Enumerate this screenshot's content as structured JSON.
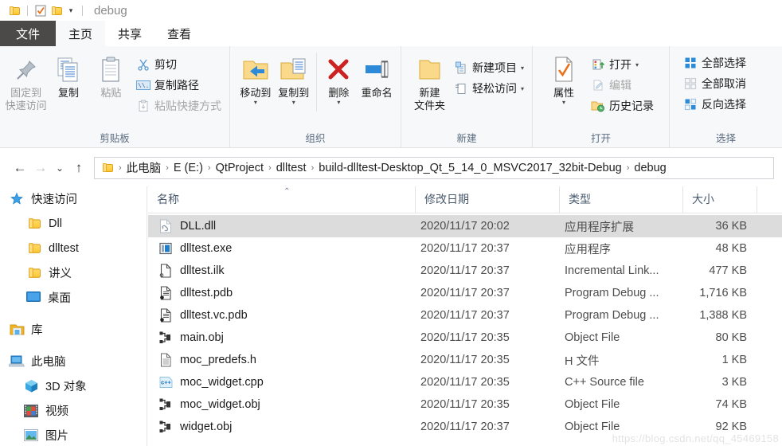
{
  "titlebar": {
    "title": "debug",
    "qat": [
      {
        "name": "folder-icon",
        "label": "folder"
      },
      {
        "name": "properties-check-icon",
        "label": "properties"
      },
      {
        "name": "new-folder-icon",
        "label": "new folder"
      }
    ],
    "customize_caret": "▾"
  },
  "tabs": [
    {
      "id": "file",
      "label": "文件",
      "state": "file"
    },
    {
      "id": "home",
      "label": "主页",
      "state": "active"
    },
    {
      "id": "share",
      "label": "共享",
      "state": "normal"
    },
    {
      "id": "view",
      "label": "查看",
      "state": "normal"
    }
  ],
  "ribbon": {
    "groups": [
      {
        "id": "clipboard",
        "title": "剪贴板",
        "big": [
          {
            "name": "pin-to-quick-access-button",
            "icon": "pin-icon",
            "line1": "固定到",
            "line2": "快速访问",
            "dim": true
          },
          {
            "name": "copy-button",
            "icon": "copy-icon",
            "line1": "复制",
            "line2": "",
            "dim": false
          },
          {
            "name": "paste-button",
            "icon": "paste-icon",
            "line1": "粘贴",
            "line2": "",
            "dim": true
          }
        ],
        "small": [
          {
            "name": "cut-button",
            "icon": "scissors-icon",
            "label": "剪切",
            "dim": false,
            "caret": ""
          },
          {
            "name": "copy-path-button",
            "icon": "copy-path-icon",
            "label": "复制路径",
            "dim": false,
            "caret": ""
          },
          {
            "name": "paste-shortcut-button",
            "icon": "paste-shortcut-icon",
            "label": "粘贴快捷方式",
            "dim": true,
            "caret": ""
          }
        ]
      },
      {
        "id": "organize",
        "title": "组织",
        "big": [
          {
            "name": "move-to-button",
            "icon": "move-to-icon",
            "line1": "移动到",
            "line2": "",
            "caret": "▾"
          },
          {
            "name": "copy-to-button",
            "icon": "copy-to-icon",
            "line1": "复制到",
            "line2": "",
            "caret": "▾"
          },
          {
            "name": "delete-button",
            "icon": "delete-x-icon",
            "line1": "删除",
            "line2": "",
            "caret": "▾"
          },
          {
            "name": "rename-button",
            "icon": "rename-icon",
            "line1": "重命名",
            "line2": "",
            "caret": ""
          }
        ],
        "small": []
      },
      {
        "id": "new",
        "title": "新建",
        "big": [
          {
            "name": "new-folder-button",
            "icon": "new-folder-icon",
            "line1": "新建",
            "line2": "文件夹",
            "caret": ""
          }
        ],
        "small": [
          {
            "name": "new-item-button",
            "icon": "new-item-icon",
            "label": "新建项目",
            "dim": false,
            "caret": "▾"
          },
          {
            "name": "easy-access-button",
            "icon": "easy-access-icon",
            "label": "轻松访问",
            "dim": false,
            "caret": "▾"
          }
        ]
      },
      {
        "id": "open",
        "title": "打开",
        "big": [
          {
            "name": "properties-button",
            "icon": "properties-icon",
            "line1": "属性",
            "line2": "",
            "caret": "▾"
          }
        ],
        "small": [
          {
            "name": "open-button",
            "icon": "open-icon",
            "label": "打开",
            "dim": false,
            "caret": "▾"
          },
          {
            "name": "edit-button",
            "icon": "edit-icon",
            "label": "编辑",
            "dim": true,
            "caret": ""
          },
          {
            "name": "history-button",
            "icon": "history-icon",
            "label": "历史记录",
            "dim": false,
            "caret": ""
          }
        ]
      },
      {
        "id": "select",
        "title": "选择",
        "big": [],
        "small": [
          {
            "name": "select-all-button",
            "icon": "select-all-icon",
            "label": "全部选择",
            "dim": false,
            "caret": ""
          },
          {
            "name": "select-none-button",
            "icon": "select-none-icon",
            "label": "全部取消",
            "dim": false,
            "caret": ""
          },
          {
            "name": "invert-selection-button",
            "icon": "invert-selection-icon",
            "label": "反向选择",
            "dim": false,
            "caret": ""
          }
        ]
      }
    ]
  },
  "addressbar": {
    "back": "←",
    "forward": "→",
    "recent": "⌄",
    "up": "↑",
    "separator": "›",
    "crumbs": [
      "此电脑",
      "E (E:)",
      "QtProject",
      "dlltest",
      "build-dlltest-Desktop_Qt_5_14_0_MSVC2017_32bit-Debug",
      "debug"
    ]
  },
  "navpane": {
    "items": [
      {
        "name": "sidebar-item-quick-access",
        "icon": "star-pin-icon",
        "label": "快速访问",
        "indent": 10
      },
      {
        "name": "sidebar-item-dll",
        "icon": "folder-icon",
        "label": "Dll",
        "indent": 32
      },
      {
        "name": "sidebar-item-dlltest",
        "icon": "folder-icon",
        "label": "dlltest",
        "indent": 32
      },
      {
        "name": "sidebar-item-jiangyi",
        "icon": "folder-icon",
        "label": "讲义",
        "indent": 32
      },
      {
        "name": "sidebar-item-desktop",
        "icon": "desktop-icon",
        "label": "桌面",
        "indent": 32
      },
      {
        "name": "sidebar-item-libraries",
        "icon": "library-icon",
        "label": "库",
        "indent": 10
      },
      {
        "name": "sidebar-item-this-pc",
        "icon": "pc-icon",
        "label": "此电脑",
        "indent": 10
      },
      {
        "name": "sidebar-item-3d-objects",
        "icon": "cube-icon",
        "label": "3D 对象",
        "indent": 28
      },
      {
        "name": "sidebar-item-videos",
        "icon": "video-icon",
        "label": "视频",
        "indent": 28
      },
      {
        "name": "sidebar-item-pictures",
        "icon": "pictures-icon",
        "label": "图片",
        "indent": 28
      }
    ]
  },
  "filelist": {
    "columns": [
      {
        "name": "column-header-name",
        "label": "名称",
        "sorted": true,
        "sort_caret": "⌃"
      },
      {
        "name": "column-header-date",
        "label": "修改日期",
        "sorted": false,
        "sort_caret": ""
      },
      {
        "name": "column-header-type",
        "label": "类型",
        "sorted": false,
        "sort_caret": ""
      },
      {
        "name": "column-header-size",
        "label": "大小",
        "sorted": false,
        "sort_caret": ""
      }
    ],
    "rows": [
      {
        "icon": "dll-file-icon",
        "name": "DLL.dll",
        "date": "2020/11/17 20:02",
        "type": "应用程序扩展",
        "size": "36 KB",
        "selected": true
      },
      {
        "icon": "exe-file-icon",
        "name": "dlltest.exe",
        "date": "2020/11/17 20:37",
        "type": "应用程序",
        "size": "48 KB",
        "selected": false
      },
      {
        "icon": "ilk-file-icon",
        "name": "dlltest.ilk",
        "date": "2020/11/17 20:37",
        "type": "Incremental Link...",
        "size": "477 KB",
        "selected": false
      },
      {
        "icon": "pdb-file-icon",
        "name": "dlltest.pdb",
        "date": "2020/11/17 20:37",
        "type": "Program Debug ...",
        "size": "1,716 KB",
        "selected": false
      },
      {
        "icon": "pdb-file-icon",
        "name": "dlltest.vc.pdb",
        "date": "2020/11/17 20:37",
        "type": "Program Debug ...",
        "size": "1,388 KB",
        "selected": false
      },
      {
        "icon": "obj-file-icon",
        "name": "main.obj",
        "date": "2020/11/17 20:35",
        "type": "Object File",
        "size": "80 KB",
        "selected": false
      },
      {
        "icon": "h-file-icon",
        "name": "moc_predefs.h",
        "date": "2020/11/17 20:35",
        "type": "H 文件",
        "size": "1 KB",
        "selected": false
      },
      {
        "icon": "cpp-file-icon",
        "name": "moc_widget.cpp",
        "date": "2020/11/17 20:35",
        "type": "C++ Source file",
        "size": "3 KB",
        "selected": false
      },
      {
        "icon": "obj-file-icon",
        "name": "moc_widget.obj",
        "date": "2020/11/17 20:35",
        "type": "Object File",
        "size": "74 KB",
        "selected": false
      },
      {
        "icon": "obj-file-icon",
        "name": "widget.obj",
        "date": "2020/11/17 20:37",
        "type": "Object File",
        "size": "92 KB",
        "selected": false
      }
    ]
  },
  "watermark": {
    "text": "https://blog.csdn.net/qq_45469158"
  },
  "colors": {
    "file_tab_bg": "#4c4a48",
    "ribbon_bg": "#f7f8f9",
    "group_title": "#5a6b80",
    "selection": "#dcdcdc",
    "accent_blue": "#2d8ad8",
    "folder_yellow": "#ffc832",
    "delete_red": "#cc2222"
  }
}
